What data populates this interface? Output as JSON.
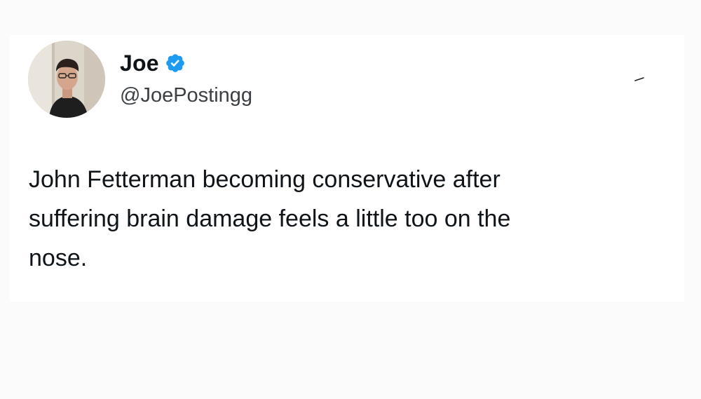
{
  "tweet": {
    "author": {
      "display_name": "Joe",
      "handle": "@JoePostingg",
      "verified": true,
      "verified_color": "#1d9bf0",
      "avatar_icon": "profile-photo"
    },
    "text": "John Fetterman becoming conservative after\nsuffering brain damage feels a little too on the\nnose."
  },
  "colors": {
    "background": "#fbfbfc",
    "card": "#ffffff",
    "text": "#0f1419",
    "handle_text": "#3a3f44"
  }
}
